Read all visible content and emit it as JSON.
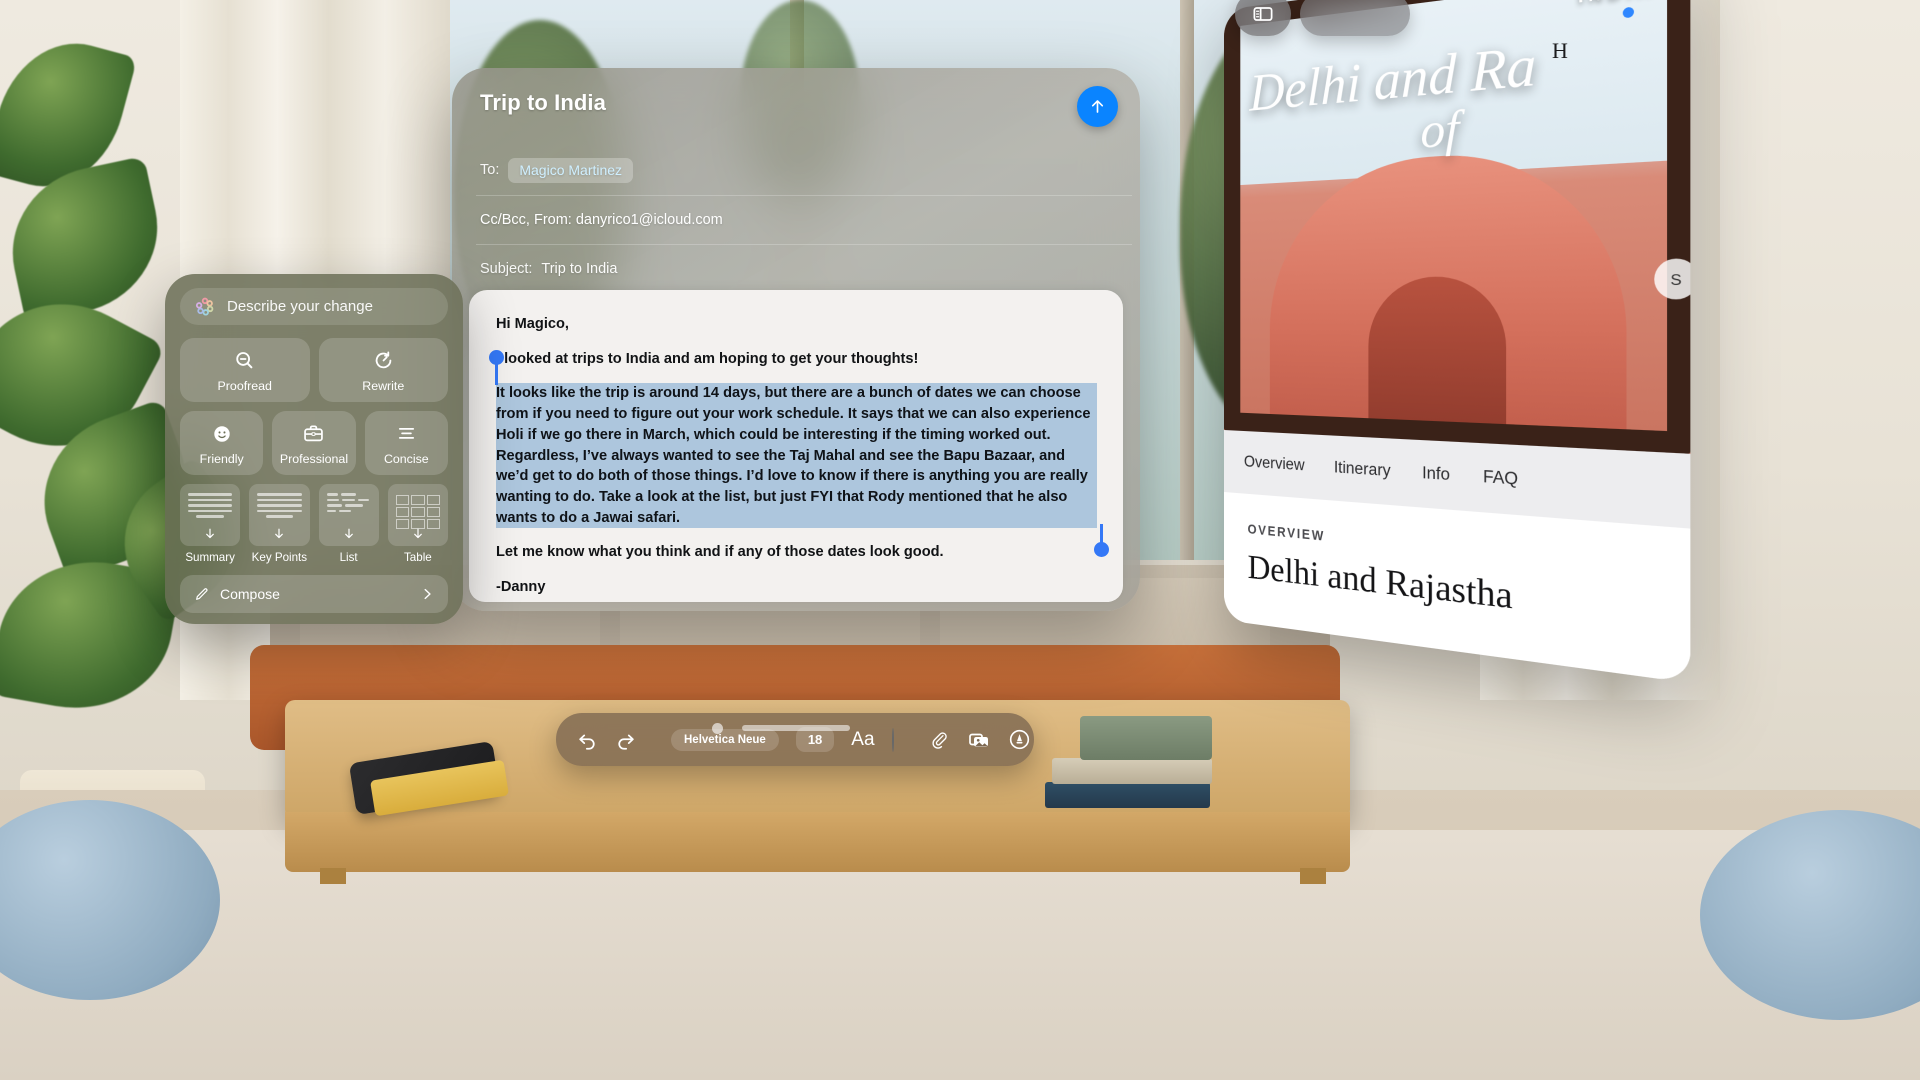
{
  "mail": {
    "title": "Trip to India",
    "send_icon": "arrow-up-icon",
    "to_label": "To:",
    "recipient": "Magico Martinez",
    "ccbcc_from": "Cc/Bcc, From: danyrico1@icloud.com",
    "subject_label": "Subject:",
    "subject_value": "Trip to India",
    "body": {
      "greeting": "Hi Magico,",
      "intro": "I looked at trips to India and am hoping to get your thoughts!",
      "selected": "It looks like the trip is around 14 days, but there are a bunch of dates we can choose from if you need to figure out your work schedule. It says that we can also experience Holi if we go there in March, which could be interesting if the timing worked out. Regardless, I’ve always wanted to see the Taj Mahal and see the Bapu Bazaar, and we’d get to do both of those things.  I’d love to know if there is anything you are really wanting to do. Take a look at the list, but just FYI that Rody mentioned that he also wants to do a Jawai safari.",
      "closing": "Let me know what you think and if any of those dates look good.",
      "signature": "-Danny"
    }
  },
  "format_toolbar": {
    "undo_icon": "undo-icon",
    "redo_icon": "redo-icon",
    "font_family": "Helvetica Neue",
    "font_size": "18",
    "text_style_label": "Aa",
    "text_color": "#171717",
    "attach_icon": "paperclip-icon",
    "photos_icon": "photos-icon",
    "markup_icon": "markup-icon"
  },
  "writing_tools": {
    "search_placeholder": "Describe your change",
    "sparkle_icon": "apple-intelligence-icon",
    "row_actions": [
      {
        "label": "Proofread",
        "icon": "magnifier-minus-icon"
      },
      {
        "label": "Rewrite",
        "icon": "rewrite-clock-icon"
      }
    ],
    "tone_actions": [
      {
        "label": "Friendly",
        "icon": "smiley-face-icon"
      },
      {
        "label": "Professional",
        "icon": "briefcase-icon"
      },
      {
        "label": "Concise",
        "icon": "concise-lines-icon"
      }
    ],
    "transform_actions": [
      {
        "label": "Summary",
        "icon": "summary-doc-icon"
      },
      {
        "label": "Key Points",
        "icon": "key-points-doc-icon"
      },
      {
        "label": "List",
        "icon": "list-doc-icon"
      },
      {
        "label": "Table",
        "icon": "table-doc-icon"
      }
    ],
    "compose": {
      "label": "Compose",
      "pencil_icon": "pencil-icon",
      "chevron_icon": "chevron-right-icon"
    }
  },
  "india_window": {
    "sidebar_icon": "sidebar-toggle-icon",
    "hero_kicker": "INDIA",
    "hero_title_line1": "Delhi and Ra",
    "hero_title_line2": "of",
    "header_letter": "H",
    "side_button_label": "S",
    "tabs": [
      "Overview",
      "Itinerary",
      "Info",
      "FAQ"
    ],
    "section_kicker": "OVERVIEW",
    "section_heading": "Delhi and Rajastha"
  },
  "colors": {
    "accent_blue": "#0a84ff",
    "selection_blue": "#adc6dd",
    "handle_blue": "#3478f6",
    "panel_olive": "rgba(104,107,84,.84)",
    "toolbar_brown": "rgba(124,103,80,.80)"
  }
}
